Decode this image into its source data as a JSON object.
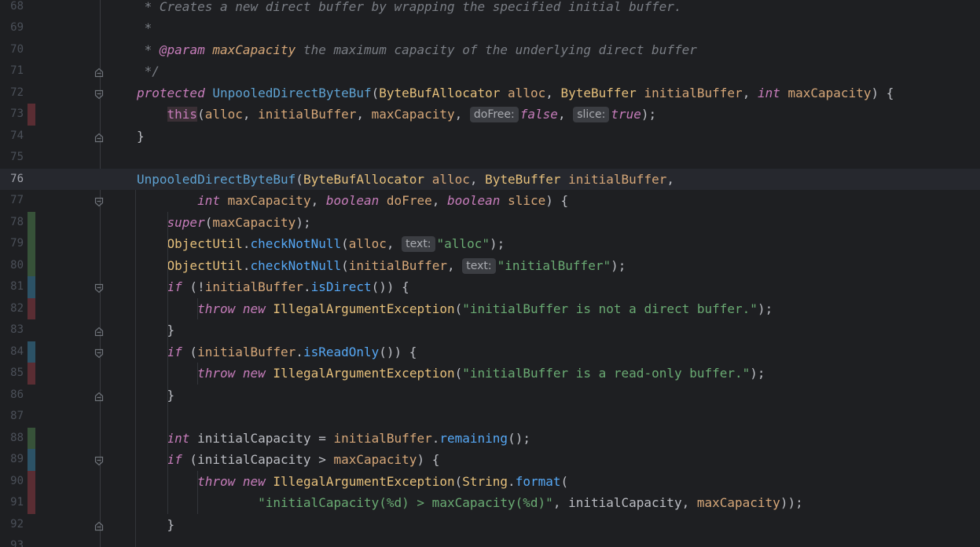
{
  "lines": [
    {
      "num": "68",
      "vcs": "",
      "fold": "",
      "current": false,
      "tokens": [
        {
          "t": " * Creates a new direct buffer by wrapping the specified initial buffer.",
          "c": "c-comment"
        }
      ]
    },
    {
      "num": "69",
      "vcs": "",
      "fold": "",
      "current": false,
      "tokens": [
        {
          "t": " *",
          "c": "c-comment"
        }
      ]
    },
    {
      "num": "70",
      "vcs": "",
      "fold": "",
      "current": false,
      "tokens": [
        {
          "t": " * ",
          "c": "c-comment"
        },
        {
          "t": "@param",
          "c": "c-kwi"
        },
        {
          "t": " ",
          "c": "c-comment"
        },
        {
          "t": "maxCapacity",
          "c": "c-param",
          "it": true
        },
        {
          "t": " the maximum capacity of the underlying direct buffer",
          "c": "c-comment"
        }
      ]
    },
    {
      "num": "71",
      "vcs": "",
      "fold": "end",
      "current": false,
      "tokens": [
        {
          "t": " */",
          "c": "c-comment"
        }
      ]
    },
    {
      "num": "72",
      "vcs": "",
      "fold": "start",
      "current": false,
      "tokens": [
        {
          "t": "protected",
          "c": "c-kwi"
        },
        {
          "t": " ",
          "c": "c-punc"
        },
        {
          "t": "UnpooledDirectByteBuf",
          "c": "c-ctor"
        },
        {
          "t": "(",
          "c": "c-punc"
        },
        {
          "t": "ByteBufAllocator",
          "c": "c-type"
        },
        {
          "t": " ",
          "c": "c-punc"
        },
        {
          "t": "alloc",
          "c": "c-param"
        },
        {
          "t": ", ",
          "c": "c-punc"
        },
        {
          "t": "ByteBuffer",
          "c": "c-type"
        },
        {
          "t": " ",
          "c": "c-punc"
        },
        {
          "t": "initialBuffer",
          "c": "c-param"
        },
        {
          "t": ", ",
          "c": "c-punc"
        },
        {
          "t": "int",
          "c": "c-kwi"
        },
        {
          "t": " ",
          "c": "c-punc"
        },
        {
          "t": "maxCapacity",
          "c": "c-param"
        },
        {
          "t": ") {",
          "c": "c-punc"
        }
      ]
    },
    {
      "num": "73",
      "vcs": "deleted",
      "fold": "",
      "current": false,
      "tokens": [
        {
          "t": "    ",
          "c": "c-punc"
        },
        {
          "t": "this",
          "c": "c-this c-bg-this"
        },
        {
          "t": "(",
          "c": "c-punc"
        },
        {
          "t": "alloc",
          "c": "c-param"
        },
        {
          "t": ", ",
          "c": "c-punc"
        },
        {
          "t": "initialBuffer",
          "c": "c-param"
        },
        {
          "t": ", ",
          "c": "c-punc"
        },
        {
          "t": "maxCapacity",
          "c": "c-param"
        },
        {
          "t": ", ",
          "c": "c-punc"
        },
        {
          "hint": "doFree:"
        },
        {
          "t": "false",
          "c": "c-kwi"
        },
        {
          "t": ", ",
          "c": "c-punc"
        },
        {
          "hint": "slice:"
        },
        {
          "t": "true",
          "c": "c-kwi"
        },
        {
          "t": ");",
          "c": "c-punc"
        }
      ]
    },
    {
      "num": "74",
      "vcs": "",
      "fold": "end",
      "current": false,
      "tokens": [
        {
          "t": "}",
          "c": "c-punc"
        }
      ]
    },
    {
      "num": "75",
      "vcs": "",
      "fold": "",
      "current": false,
      "tokens": []
    },
    {
      "num": "76",
      "vcs": "",
      "fold": "",
      "current": true,
      "tokens": [
        {
          "t": "UnpooledDirectByteBuf",
          "c": "c-ctor"
        },
        {
          "t": "(",
          "c": "c-punc"
        },
        {
          "t": "ByteBufAllocator",
          "c": "c-type"
        },
        {
          "t": " ",
          "c": "c-punc"
        },
        {
          "t": "alloc",
          "c": "c-param"
        },
        {
          "t": ", ",
          "c": "c-punc"
        },
        {
          "t": "ByteBuffer",
          "c": "c-type"
        },
        {
          "t": " ",
          "c": "c-punc"
        },
        {
          "t": "initialBuffer",
          "c": "c-param"
        },
        {
          "t": ",",
          "c": "c-punc"
        }
      ]
    },
    {
      "num": "77",
      "vcs": "",
      "fold": "start",
      "current": false,
      "tokens": [
        {
          "t": "        ",
          "c": "c-punc"
        },
        {
          "t": "int",
          "c": "c-kwi"
        },
        {
          "t": " ",
          "c": "c-punc"
        },
        {
          "t": "maxCapacity",
          "c": "c-param"
        },
        {
          "t": ", ",
          "c": "c-punc"
        },
        {
          "t": "boolean",
          "c": "c-kwi"
        },
        {
          "t": " ",
          "c": "c-punc"
        },
        {
          "t": "doFree",
          "c": "c-param"
        },
        {
          "t": ", ",
          "c": "c-punc"
        },
        {
          "t": "boolean",
          "c": "c-kwi"
        },
        {
          "t": " ",
          "c": "c-punc"
        },
        {
          "t": "slice",
          "c": "c-param"
        },
        {
          "t": ") {",
          "c": "c-punc"
        }
      ]
    },
    {
      "num": "78",
      "vcs": "added",
      "fold": "",
      "current": false,
      "tokens": [
        {
          "t": "    ",
          "c": "c-punc"
        },
        {
          "t": "super",
          "c": "c-kwi"
        },
        {
          "t": "(",
          "c": "c-punc"
        },
        {
          "t": "maxCapacity",
          "c": "c-param"
        },
        {
          "t": ");",
          "c": "c-punc"
        }
      ]
    },
    {
      "num": "79",
      "vcs": "added",
      "fold": "",
      "current": false,
      "tokens": [
        {
          "t": "    ",
          "c": "c-punc"
        },
        {
          "t": "ObjectUtil",
          "c": "c-type"
        },
        {
          "t": ".",
          "c": "c-punc"
        },
        {
          "t": "checkNotNull",
          "c": "c-fn"
        },
        {
          "t": "(",
          "c": "c-punc"
        },
        {
          "t": "alloc",
          "c": "c-param"
        },
        {
          "t": ", ",
          "c": "c-punc"
        },
        {
          "hint": "text:"
        },
        {
          "t": "\"alloc\"",
          "c": "c-str"
        },
        {
          "t": ");",
          "c": "c-punc"
        }
      ]
    },
    {
      "num": "80",
      "vcs": "added",
      "fold": "",
      "current": false,
      "tokens": [
        {
          "t": "    ",
          "c": "c-punc"
        },
        {
          "t": "ObjectUtil",
          "c": "c-type"
        },
        {
          "t": ".",
          "c": "c-punc"
        },
        {
          "t": "checkNotNull",
          "c": "c-fn"
        },
        {
          "t": "(",
          "c": "c-punc"
        },
        {
          "t": "initialBuffer",
          "c": "c-param"
        },
        {
          "t": ", ",
          "c": "c-punc"
        },
        {
          "hint": "text:"
        },
        {
          "t": "\"initialBuffer\"",
          "c": "c-str"
        },
        {
          "t": ");",
          "c": "c-punc"
        }
      ]
    },
    {
      "num": "81",
      "vcs": "modified",
      "fold": "start",
      "current": false,
      "tokens": [
        {
          "t": "    ",
          "c": "c-punc"
        },
        {
          "t": "if",
          "c": "c-kwi"
        },
        {
          "t": " (!",
          "c": "c-punc"
        },
        {
          "t": "initialBuffer",
          "c": "c-param"
        },
        {
          "t": ".",
          "c": "c-punc"
        },
        {
          "t": "isDirect",
          "c": "c-fn"
        },
        {
          "t": "()) {",
          "c": "c-punc"
        }
      ]
    },
    {
      "num": "82",
      "vcs": "deleted",
      "fold": "",
      "current": false,
      "tokens": [
        {
          "t": "        ",
          "c": "c-punc"
        },
        {
          "t": "throw",
          "c": "c-kwi"
        },
        {
          "t": " ",
          "c": "c-punc"
        },
        {
          "t": "new",
          "c": "c-kwi"
        },
        {
          "t": " ",
          "c": "c-punc"
        },
        {
          "t": "IllegalArgumentException",
          "c": "c-type"
        },
        {
          "t": "(",
          "c": "c-punc"
        },
        {
          "t": "\"initialBuffer is not a direct buffer.\"",
          "c": "c-str"
        },
        {
          "t": ");",
          "c": "c-punc"
        }
      ]
    },
    {
      "num": "83",
      "vcs": "",
      "fold": "end",
      "current": false,
      "tokens": [
        {
          "t": "    ",
          "c": "c-punc"
        },
        {
          "t": "}",
          "c": "c-punc"
        }
      ]
    },
    {
      "num": "84",
      "vcs": "modified",
      "fold": "start",
      "current": false,
      "tokens": [
        {
          "t": "    ",
          "c": "c-punc"
        },
        {
          "t": "if",
          "c": "c-kwi"
        },
        {
          "t": " (",
          "c": "c-punc"
        },
        {
          "t": "initialBuffer",
          "c": "c-param"
        },
        {
          "t": ".",
          "c": "c-punc"
        },
        {
          "t": "isReadOnly",
          "c": "c-fn"
        },
        {
          "t": "()) {",
          "c": "c-punc"
        }
      ]
    },
    {
      "num": "85",
      "vcs": "deleted",
      "fold": "",
      "current": false,
      "tokens": [
        {
          "t": "        ",
          "c": "c-punc"
        },
        {
          "t": "throw",
          "c": "c-kwi"
        },
        {
          "t": " ",
          "c": "c-punc"
        },
        {
          "t": "new",
          "c": "c-kwi"
        },
        {
          "t": " ",
          "c": "c-punc"
        },
        {
          "t": "IllegalArgumentException",
          "c": "c-type"
        },
        {
          "t": "(",
          "c": "c-punc"
        },
        {
          "t": "\"initialBuffer is a read-only buffer.\"",
          "c": "c-str"
        },
        {
          "t": ");",
          "c": "c-punc"
        }
      ]
    },
    {
      "num": "86",
      "vcs": "",
      "fold": "end",
      "current": false,
      "tokens": [
        {
          "t": "    ",
          "c": "c-punc"
        },
        {
          "t": "}",
          "c": "c-punc"
        }
      ]
    },
    {
      "num": "87",
      "vcs": "",
      "fold": "",
      "current": false,
      "tokens": []
    },
    {
      "num": "88",
      "vcs": "added",
      "fold": "",
      "current": false,
      "tokens": [
        {
          "t": "    ",
          "c": "c-punc"
        },
        {
          "t": "int",
          "c": "c-kwi"
        },
        {
          "t": " ",
          "c": "c-punc"
        },
        {
          "t": "initialCapacity",
          "c": "c-local"
        },
        {
          "t": " = ",
          "c": "c-punc"
        },
        {
          "t": "initialBuffer",
          "c": "c-param"
        },
        {
          "t": ".",
          "c": "c-punc"
        },
        {
          "t": "remaining",
          "c": "c-fn"
        },
        {
          "t": "();",
          "c": "c-punc"
        }
      ]
    },
    {
      "num": "89",
      "vcs": "modified",
      "fold": "start",
      "current": false,
      "tokens": [
        {
          "t": "    ",
          "c": "c-punc"
        },
        {
          "t": "if",
          "c": "c-kwi"
        },
        {
          "t": " (",
          "c": "c-punc"
        },
        {
          "t": "initialCapacity",
          "c": "c-local"
        },
        {
          "t": " > ",
          "c": "c-punc"
        },
        {
          "t": "maxCapacity",
          "c": "c-param"
        },
        {
          "t": ") {",
          "c": "c-punc"
        }
      ]
    },
    {
      "num": "90",
      "vcs": "deleted",
      "fold": "",
      "current": false,
      "tokens": [
        {
          "t": "        ",
          "c": "c-punc"
        },
        {
          "t": "throw",
          "c": "c-kwi"
        },
        {
          "t": " ",
          "c": "c-punc"
        },
        {
          "t": "new",
          "c": "c-kwi"
        },
        {
          "t": " ",
          "c": "c-punc"
        },
        {
          "t": "IllegalArgumentException",
          "c": "c-type"
        },
        {
          "t": "(",
          "c": "c-punc"
        },
        {
          "t": "String",
          "c": "c-type"
        },
        {
          "t": ".",
          "c": "c-punc"
        },
        {
          "t": "format",
          "c": "c-fn"
        },
        {
          "t": "(",
          "c": "c-punc"
        }
      ]
    },
    {
      "num": "91",
      "vcs": "deleted",
      "fold": "",
      "current": false,
      "tokens": [
        {
          "t": "                ",
          "c": "c-punc"
        },
        {
          "t": "\"initialCapacity(%d) > maxCapacity(%d)\"",
          "c": "c-str"
        },
        {
          "t": ", ",
          "c": "c-punc"
        },
        {
          "t": "initialCapacity",
          "c": "c-local"
        },
        {
          "t": ", ",
          "c": "c-punc"
        },
        {
          "t": "maxCapacity",
          "c": "c-param"
        },
        {
          "t": "));",
          "c": "c-punc"
        }
      ]
    },
    {
      "num": "92",
      "vcs": "",
      "fold": "end",
      "current": false,
      "tokens": [
        {
          "t": "    ",
          "c": "c-punc"
        },
        {
          "t": "}",
          "c": "c-punc"
        }
      ]
    },
    {
      "num": "93",
      "vcs": "",
      "fold": "",
      "current": false,
      "tokens": []
    }
  ],
  "colors": {
    "background": "#1e1f22",
    "current_line": "#26282e",
    "vcs_added": "#375239",
    "vcs_modified": "#2c5266",
    "vcs_deleted": "#5a2d33"
  },
  "icons": {
    "fold_start": "fold-start-icon",
    "fold_end": "fold-end-icon"
  }
}
